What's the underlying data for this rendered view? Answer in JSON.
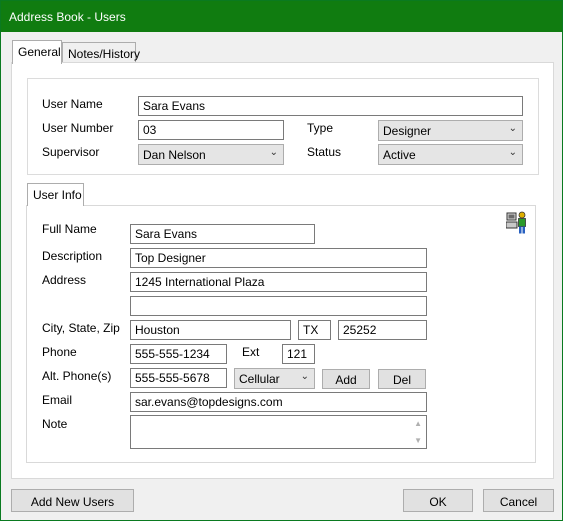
{
  "window": {
    "title": "Address Book - Users"
  },
  "tabs": [
    {
      "label": "General",
      "active": true
    },
    {
      "label": "Notes/History",
      "active": false
    }
  ],
  "general": {
    "user_name_label": "User Name",
    "user_name_value": "Sara Evans",
    "user_number_label": "User Number",
    "user_number_value": "03",
    "type_label": "Type",
    "type_value": "Designer",
    "supervisor_label": "Supervisor",
    "supervisor_value": "Dan Nelson",
    "status_label": "Status",
    "status_value": "Active"
  },
  "user_info": {
    "tab_label": "User Info",
    "full_name_label": "Full Name",
    "full_name_value": "Sara Evans",
    "description_label": "Description",
    "description_value": "Top Designer",
    "address_label": "Address",
    "address_line1": "1245 International Plaza",
    "address_line2": "",
    "city_state_zip_label": "City, State, Zip",
    "city_value": "Houston",
    "state_value": "TX",
    "zip_value": "25252",
    "phone_label": "Phone",
    "phone_value": "555-555-1234",
    "ext_label": "Ext",
    "ext_value": "121",
    "alt_phone_label": "Alt. Phone(s)",
    "alt_phone_value": "555-555-5678",
    "alt_phone_type": "Cellular",
    "add_label": "Add",
    "del_label": "Del",
    "email_label": "Email",
    "email_value": "sar.evans@topdesigns.com",
    "note_label": "Note",
    "note_value": ""
  },
  "footer": {
    "add_new_users_label": "Add New Users",
    "ok_label": "OK",
    "cancel_label": "Cancel"
  },
  "icons": {
    "user_computer_icon": "user-computer-icon",
    "dropdown_chevron": "chevron-down-icon"
  },
  "colors": {
    "titlebar": "#107c10",
    "window_bg": "#f0f0f0"
  }
}
